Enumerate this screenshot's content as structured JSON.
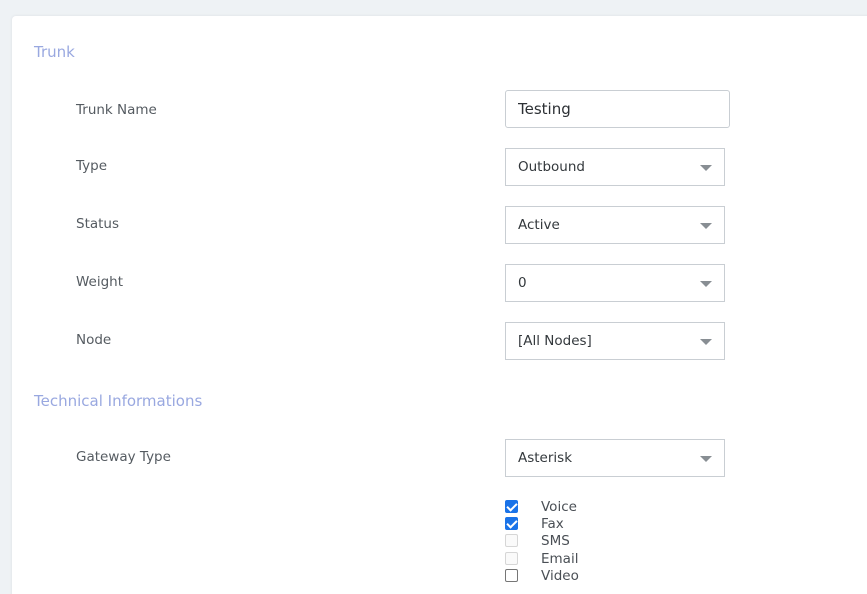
{
  "sections": {
    "trunk": "Trunk",
    "technical": "Technical Informations"
  },
  "fields": {
    "trunk_name": {
      "label": "Trunk Name",
      "value": "Testing"
    },
    "type": {
      "label": "Type",
      "value": "Outbound"
    },
    "status": {
      "label": "Status",
      "value": "Active"
    },
    "weight": {
      "label": "Weight",
      "value": "0"
    },
    "node": {
      "label": "Node",
      "value": "[All Nodes]"
    },
    "gateway_type": {
      "label": "Gateway Type",
      "value": "Asterisk"
    }
  },
  "capabilities": [
    {
      "label": "Voice",
      "checked": true,
      "disabled": false
    },
    {
      "label": "Fax",
      "checked": true,
      "disabled": false
    },
    {
      "label": "SMS",
      "checked": false,
      "disabled": true
    },
    {
      "label": "Email",
      "checked": false,
      "disabled": true
    },
    {
      "label": "Video",
      "checked": false,
      "disabled": false
    }
  ],
  "colors": {
    "section_title": "#99a8e0",
    "checkbox_checked": "#1a73e8"
  }
}
